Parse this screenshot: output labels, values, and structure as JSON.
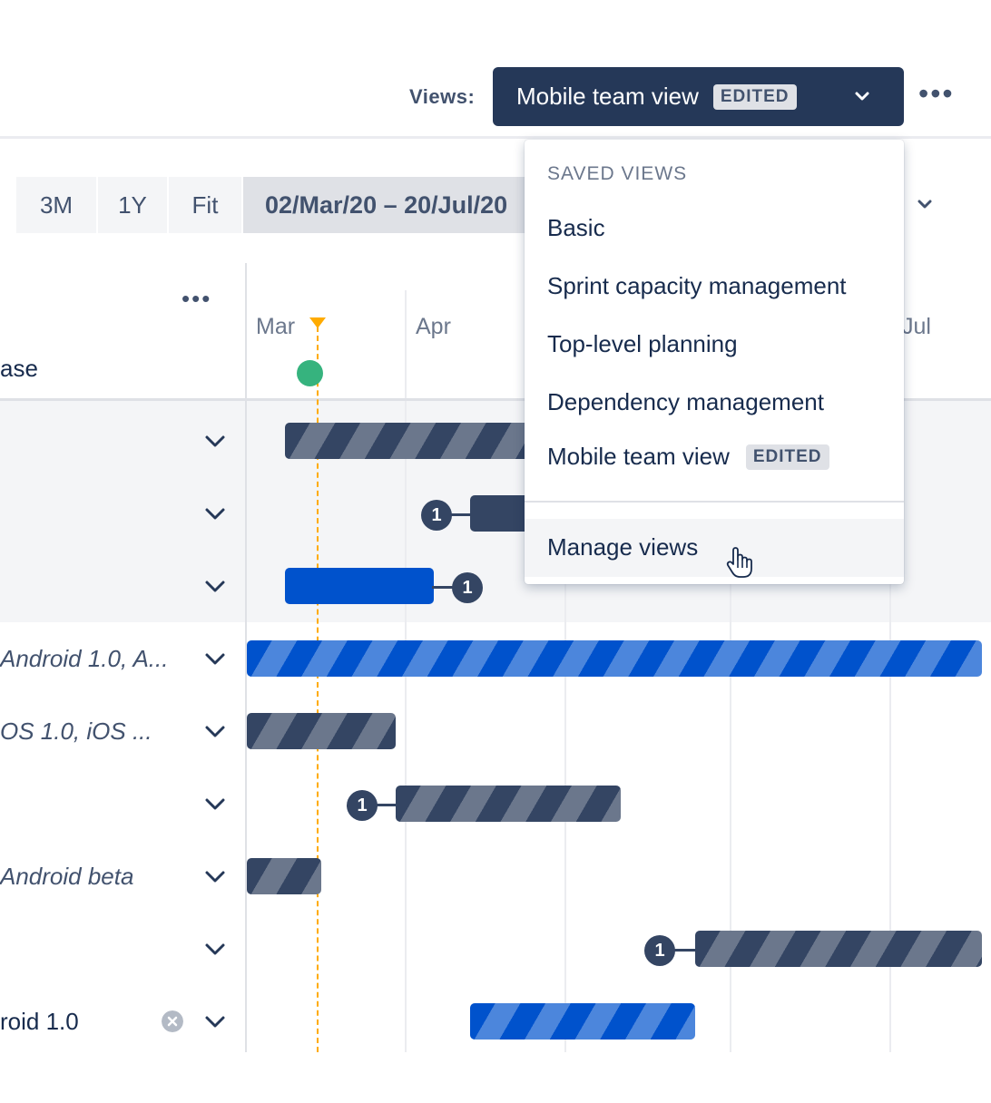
{
  "header": {
    "views_label": "Views:",
    "current_view": "Mobile team view",
    "current_view_badge": "EDITED",
    "more_label": "•••"
  },
  "zoom": {
    "options": [
      "3M",
      "1Y",
      "Fit"
    ],
    "date_range": "02/Mar/20 – 20/Jul/20"
  },
  "list": {
    "more_label": "•••",
    "column_header": "ase",
    "rows": [
      {
        "label": ""
      },
      {
        "label": ""
      },
      {
        "label": ""
      },
      {
        "label": "Android 1.0, A..."
      },
      {
        "label": "OS 1.0, iOS ..."
      },
      {
        "label": ""
      },
      {
        "label": "Android beta"
      },
      {
        "label": ""
      },
      {
        "label": "roid 1.0"
      }
    ]
  },
  "timeline": {
    "months": [
      "Mar",
      "Apr",
      "Jul"
    ],
    "dependency_count": "1"
  },
  "dropdown": {
    "heading": "SAVED VIEWS",
    "items": [
      {
        "label": "Basic",
        "badge": ""
      },
      {
        "label": "Sprint capacity management",
        "badge": ""
      },
      {
        "label": "Top-level planning",
        "badge": ""
      },
      {
        "label": "Dependency management",
        "badge": ""
      },
      {
        "label": "Mobile team view",
        "badge": "EDITED"
      }
    ],
    "manage_label": "Manage views"
  },
  "colors": {
    "navy": "#253858",
    "blue": "#0052cc",
    "today": "#ffab00",
    "release": "#36b37e"
  },
  "icons": [
    "chevron-down-icon",
    "more-icon",
    "clear-icon",
    "hand-cursor-icon"
  ]
}
